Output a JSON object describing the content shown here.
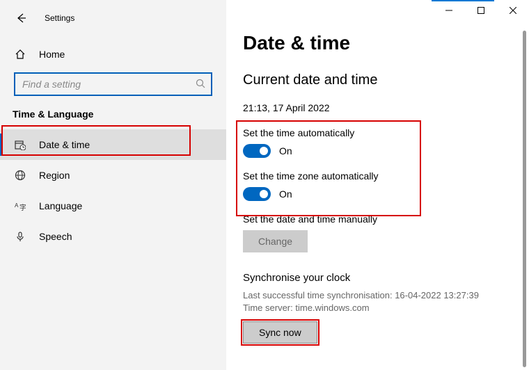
{
  "window": {
    "title": "Settings"
  },
  "sidebar": {
    "home_label": "Home",
    "search_placeholder": "Find a setting",
    "category": "Time & Language",
    "items": [
      {
        "label": "Date & time"
      },
      {
        "label": "Region"
      },
      {
        "label": "Language"
      },
      {
        "label": "Speech"
      }
    ]
  },
  "main": {
    "title": "Date & time",
    "subtitle": "Current date and time",
    "now": "21:13, 17 April 2022",
    "auto_time_label": "Set the time automatically",
    "auto_time_state": "On",
    "auto_tz_label": "Set the time zone automatically",
    "auto_tz_state": "On",
    "manual_label": "Set the date and time manually",
    "change_button": "Change",
    "sync_heading": "Synchronise your clock",
    "sync_last": "Last successful time synchronisation: 16-04-2022 13:27:39",
    "sync_server": "Time server: time.windows.com",
    "sync_button": "Sync now"
  }
}
